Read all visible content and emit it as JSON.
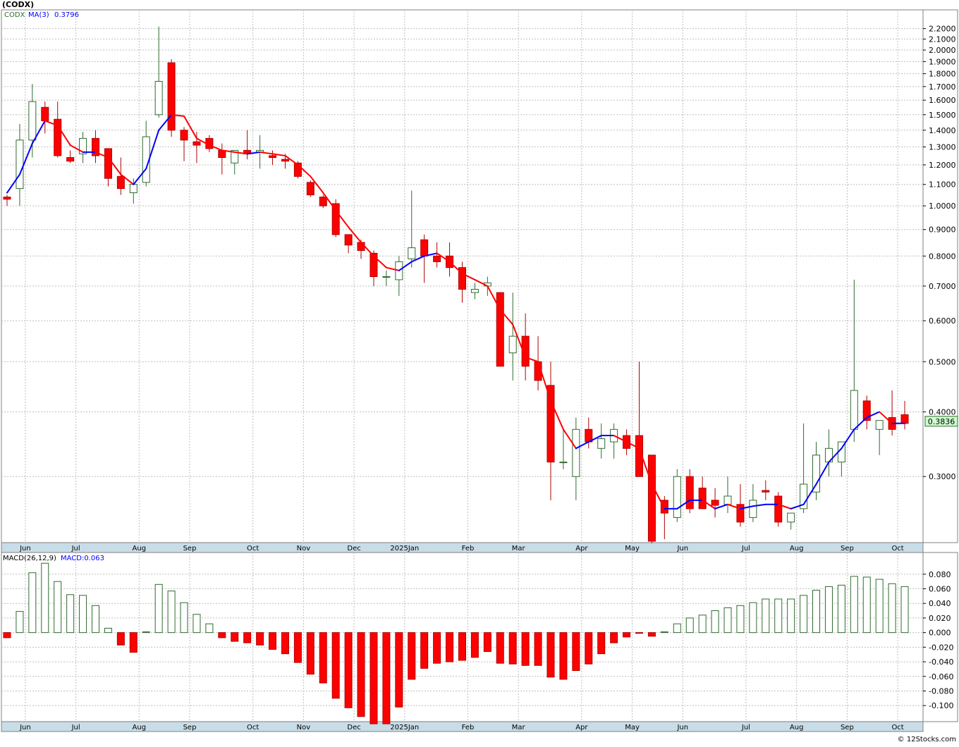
{
  "title": "(CODX)",
  "footer": "© 12Stocks.com",
  "colors": {
    "up_fill": "#ffffff",
    "up_stroke": "#2f6b2f",
    "down_fill": "#ff0000",
    "down_stroke": "#b00000",
    "ma_up": "#0000ff",
    "ma_down": "#ff0000",
    "grid": "#bfbfbf",
    "axis_band": "#c8dde8",
    "last_price_bg": "#ccffcc"
  },
  "chart_data": [
    {
      "type": "candlestick",
      "legend": {
        "symbol": "CODX",
        "ma_label": "MA(3)",
        "ma_value": "0.3796"
      },
      "y_scale": "log",
      "ylim": [
        0.225,
        2.26
      ],
      "grid": true,
      "y_ticks": [
        "2.2000",
        "2.1000",
        "2.0000",
        "1.9000",
        "1.8000",
        "1.7000",
        "1.6000",
        "1.5000",
        "1.4000",
        "1.3000",
        "1.2000",
        "1.1000",
        "1.0000",
        "0.9000",
        "0.8000",
        "0.7000",
        "0.6000",
        "0.5000",
        "0.4000",
        "0.3000"
      ],
      "last_price": "0.3836",
      "x_labels": [
        "Jun",
        "Jul",
        "Aug",
        "Sep",
        "Oct",
        "Nov",
        "Dec",
        "2025Jan",
        "Feb",
        "Mar",
        "Apr",
        "May",
        "Jun",
        "Jul",
        "Aug",
        "Sep",
        "Oct"
      ],
      "x_label_weeks": [
        1,
        5,
        10,
        14,
        19,
        23,
        27,
        31,
        36,
        40,
        45,
        49,
        53,
        58,
        62,
        66,
        70
      ],
      "candles": [
        [
          1.04,
          1.05,
          1.0,
          1.03
        ],
        [
          1.08,
          1.44,
          1.0,
          1.34
        ],
        [
          1.34,
          1.72,
          1.24,
          1.59
        ],
        [
          1.55,
          1.59,
          1.38,
          1.46
        ],
        [
          1.47,
          1.59,
          1.24,
          1.25
        ],
        [
          1.24,
          1.28,
          1.21,
          1.22
        ],
        [
          1.26,
          1.39,
          1.21,
          1.35
        ],
        [
          1.35,
          1.4,
          1.21,
          1.25
        ],
        [
          1.29,
          1.29,
          1.09,
          1.13
        ],
        [
          1.14,
          1.24,
          1.05,
          1.08
        ],
        [
          1.06,
          1.13,
          1.01,
          1.1
        ],
        [
          1.11,
          1.46,
          1.09,
          1.36
        ],
        [
          1.5,
          2.22,
          1.48,
          1.74
        ],
        [
          1.89,
          1.92,
          1.36,
          1.4
        ],
        [
          1.4,
          1.42,
          1.22,
          1.34
        ],
        [
          1.33,
          1.39,
          1.21,
          1.31
        ],
        [
          1.35,
          1.37,
          1.27,
          1.29
        ],
        [
          1.28,
          1.32,
          1.15,
          1.24
        ],
        [
          1.21,
          1.28,
          1.15,
          1.28
        ],
        [
          1.28,
          1.4,
          1.23,
          1.26
        ],
        [
          1.27,
          1.37,
          1.18,
          1.28
        ],
        [
          1.25,
          1.28,
          1.2,
          1.24
        ],
        [
          1.23,
          1.26,
          1.18,
          1.22
        ],
        [
          1.21,
          1.22,
          1.13,
          1.14
        ],
        [
          1.11,
          1.12,
          1.04,
          1.05
        ],
        [
          1.04,
          1.05,
          0.99,
          1.0
        ],
        [
          1.01,
          1.03,
          0.87,
          0.88
        ],
        [
          0.88,
          0.88,
          0.81,
          0.84
        ],
        [
          0.85,
          0.86,
          0.79,
          0.82
        ],
        [
          0.81,
          0.82,
          0.7,
          0.73
        ],
        [
          0.73,
          0.75,
          0.7,
          0.73
        ],
        [
          0.72,
          0.8,
          0.67,
          0.78
        ],
        [
          0.79,
          1.07,
          0.76,
          0.83
        ],
        [
          0.86,
          0.88,
          0.71,
          0.8
        ],
        [
          0.8,
          0.85,
          0.76,
          0.78
        ],
        [
          0.8,
          0.85,
          0.73,
          0.76
        ],
        [
          0.76,
          0.78,
          0.65,
          0.69
        ],
        [
          0.68,
          0.71,
          0.66,
          0.69
        ],
        [
          0.7,
          0.73,
          0.67,
          0.71
        ],
        [
          0.68,
          0.68,
          0.49,
          0.49
        ],
        [
          0.52,
          0.68,
          0.46,
          0.56
        ],
        [
          0.56,
          0.62,
          0.46,
          0.49
        ],
        [
          0.5,
          0.56,
          0.44,
          0.46
        ],
        [
          0.45,
          0.5,
          0.27,
          0.32
        ],
        [
          0.32,
          0.37,
          0.31,
          0.32
        ],
        [
          0.3,
          0.39,
          0.27,
          0.37
        ],
        [
          0.37,
          0.39,
          0.34,
          0.35
        ],
        [
          0.34,
          0.38,
          0.325,
          0.355
        ],
        [
          0.35,
          0.38,
          0.325,
          0.37
        ],
        [
          0.36,
          0.37,
          0.33,
          0.34
        ],
        [
          0.36,
          0.5,
          0.3,
          0.3
        ],
        [
          0.33,
          0.33,
          0.223,
          0.225
        ],
        [
          0.27,
          0.275,
          0.227,
          0.255
        ],
        [
          0.25,
          0.31,
          0.245,
          0.3
        ],
        [
          0.3,
          0.31,
          0.255,
          0.26
        ],
        [
          0.285,
          0.3,
          0.26,
          0.26
        ],
        [
          0.27,
          0.285,
          0.25,
          0.264
        ],
        [
          0.265,
          0.3,
          0.255,
          0.275
        ],
        [
          0.265,
          0.29,
          0.24,
          0.245
        ],
        [
          0.25,
          0.29,
          0.245,
          0.27
        ],
        [
          0.282,
          0.295,
          0.27,
          0.28
        ],
        [
          0.275,
          0.28,
          0.24,
          0.245
        ],
        [
          0.245,
          0.25,
          0.237,
          0.255
        ],
        [
          0.26,
          0.38,
          0.255,
          0.29
        ],
        [
          0.28,
          0.35,
          0.27,
          0.33
        ],
        [
          0.32,
          0.37,
          0.3,
          0.34
        ],
        [
          0.32,
          0.35,
          0.3,
          0.35
        ],
        [
          0.37,
          0.72,
          0.35,
          0.44
        ],
        [
          0.42,
          0.43,
          0.37,
          0.385
        ],
        [
          0.37,
          0.38,
          0.33,
          0.385
        ],
        [
          0.39,
          0.44,
          0.36,
          0.37
        ],
        [
          0.395,
          0.42,
          0.37,
          0.38
        ]
      ],
      "ma3": [
        1.06,
        1.15,
        1.32,
        1.46,
        1.43,
        1.31,
        1.27,
        1.27,
        1.24,
        1.15,
        1.1,
        1.18,
        1.4,
        1.5,
        1.49,
        1.35,
        1.31,
        1.28,
        1.27,
        1.26,
        1.27,
        1.26,
        1.25,
        1.2,
        1.14,
        1.06,
        0.98,
        0.91,
        0.85,
        0.8,
        0.76,
        0.75,
        0.78,
        0.8,
        0.81,
        0.78,
        0.74,
        0.72,
        0.7,
        0.63,
        0.59,
        0.51,
        0.5,
        0.42,
        0.37,
        0.34,
        0.35,
        0.36,
        0.36,
        0.35,
        0.34,
        0.29,
        0.26,
        0.26,
        0.27,
        0.27,
        0.26,
        0.265,
        0.26,
        0.263,
        0.265,
        0.265,
        0.26,
        0.265,
        0.29,
        0.32,
        0.34,
        0.37,
        0.39,
        0.4,
        0.38,
        0.38
      ]
    },
    {
      "type": "bar",
      "legend": {
        "label": "MACD(26,12,9)",
        "value_label": "MACD:0.063"
      },
      "ylim": [
        -0.122,
        0.102
      ],
      "y_ticks": [
        "0.080",
        "0.060",
        "0.040",
        "0.020",
        "0.000",
        "-0.020",
        "-0.040",
        "-0.060",
        "-0.080",
        "-0.100"
      ],
      "x_labels": [
        "Jun",
        "Jul",
        "Aug",
        "Sep",
        "Oct",
        "Nov",
        "Dec",
        "2025Jan",
        "Feb",
        "Mar",
        "Apr",
        "May",
        "Jun",
        "Jul",
        "Aug",
        "Sep",
        "Oct"
      ],
      "values": [
        -0.007,
        0.029,
        0.082,
        0.095,
        0.07,
        0.052,
        0.051,
        0.037,
        0.006,
        -0.017,
        -0.027,
        0.001,
        0.066,
        0.057,
        0.041,
        0.025,
        0.012,
        -0.007,
        -0.012,
        -0.014,
        -0.017,
        -0.023,
        -0.029,
        -0.041,
        -0.057,
        -0.069,
        -0.09,
        -0.103,
        -0.115,
        -0.125,
        -0.125,
        -0.102,
        -0.064,
        -0.049,
        -0.042,
        -0.04,
        -0.038,
        -0.034,
        -0.026,
        -0.042,
        -0.043,
        -0.045,
        -0.045,
        -0.061,
        -0.064,
        -0.052,
        -0.043,
        -0.029,
        -0.014,
        -0.006,
        -0.001,
        -0.005,
        0.001,
        0.012,
        0.02,
        0.024,
        0.03,
        0.034,
        0.037,
        0.041,
        0.046,
        0.046,
        0.046,
        0.051,
        0.058,
        0.063,
        0.065,
        0.077,
        0.076,
        0.073,
        0.067,
        0.063
      ]
    }
  ]
}
